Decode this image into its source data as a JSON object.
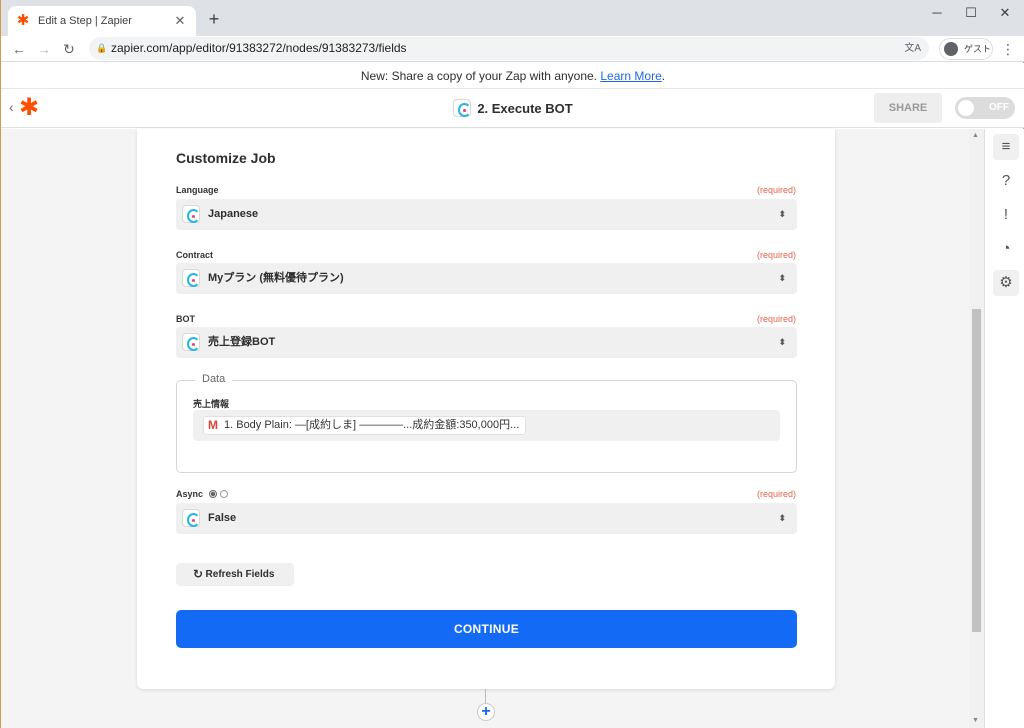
{
  "browser": {
    "tab_title": "Edit a Step | Zapier",
    "tab_close": "✕",
    "new_tab": "+",
    "url": "zapier.com/app/editor/91383272/nodes/91383273/fields",
    "profile_label": "ゲスト",
    "icons": [
      "zapier-favicon",
      "back-arrow-icon",
      "forward-arrow-icon",
      "reload-icon",
      "lock-icon",
      "translate-icon",
      "profile-avatar-icon",
      "kebab-menu-icon",
      "minimize-icon",
      "maximize-icon",
      "close-window-icon"
    ]
  },
  "banner": {
    "text": "New: Share a copy of your Zap with anyone.",
    "link": "Learn More",
    "link_suffix": "."
  },
  "header": {
    "step_title": "2. Execute BOT",
    "share_label": "SHARE",
    "toggle_label": "OFF",
    "toggle_state": "off",
    "app_icon": "bot-app-icon"
  },
  "form": {
    "section_title": "Customize Job",
    "required_text": "(required)",
    "fields": [
      {
        "label": "Language",
        "value": "Japanese"
      },
      {
        "label": "Contract",
        "value": "Myプラン (無料優待プラン)"
      },
      {
        "label": "BOT",
        "value": "売上登録BOT"
      }
    ],
    "data": {
      "legend": "Data",
      "sub_label": "売上情報",
      "pill_text": "1. Body Plain: —[成約しま] ————...成約金額:350,000円..."
    },
    "async": {
      "label": "Async",
      "value": "False",
      "radio_selected": 0
    },
    "refresh_label": "Refresh Fields",
    "continue_label": "CONTINUE"
  },
  "sidepanel": {
    "icons": [
      "details-list-icon",
      "help-icon",
      "alert-icon",
      "history-icon",
      "settings-icon"
    ]
  },
  "colors": {
    "accent": "#136bf5",
    "brand": "#ff4f00",
    "required": "#e8634c",
    "link": "#1f67ea"
  }
}
